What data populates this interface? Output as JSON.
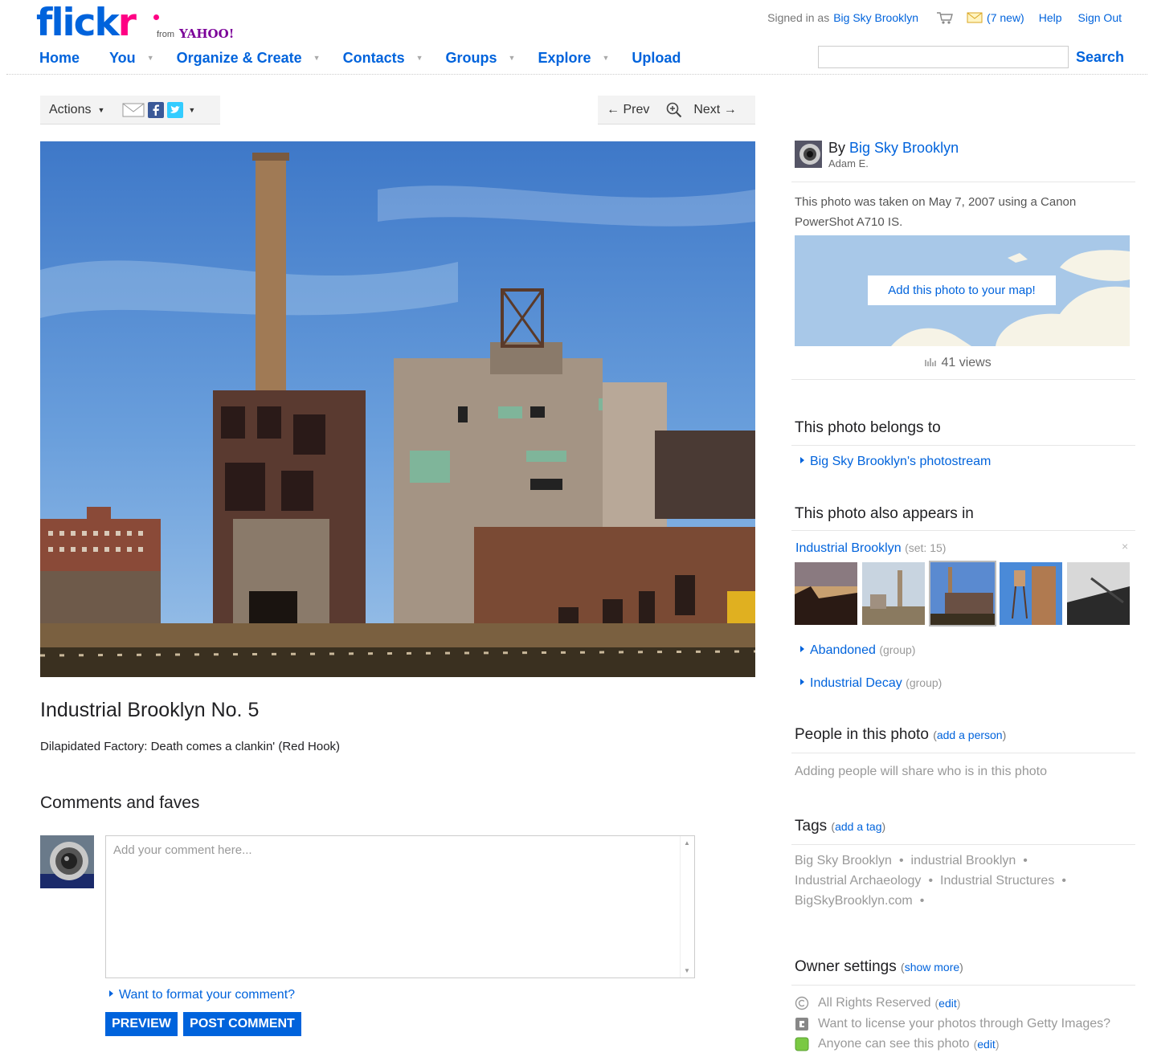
{
  "header": {
    "logo": {
      "part1": "flick",
      "part2": "r",
      "from": "from",
      "yahoo": "YAHOO!"
    },
    "nav": [
      {
        "label": "Home",
        "has_menu": false
      },
      {
        "label": "You",
        "has_menu": true
      },
      {
        "label": "Organize & Create",
        "has_menu": true
      },
      {
        "label": "Contacts",
        "has_menu": true
      },
      {
        "label": "Groups",
        "has_menu": true
      },
      {
        "label": "Explore",
        "has_menu": true
      },
      {
        "label": "Upload",
        "has_menu": false
      }
    ],
    "signed_in_prefix": "Signed in as",
    "user": "Big Sky Brooklyn",
    "mail_count": "(7 new)",
    "help": "Help",
    "sign_out": "Sign Out",
    "search_value": "",
    "search_button": "Search"
  },
  "toolbar": {
    "actions": "Actions",
    "prev": "← Prev",
    "next": "Next →"
  },
  "photo": {
    "title": "Industrial Brooklyn No. 5",
    "description": "Dilapidated Factory: Death comes a clankin' (Red Hook)"
  },
  "comments": {
    "heading": "Comments and faves",
    "placeholder": "Add your comment here...",
    "format_link": "Want to format your comment?",
    "preview": "PREVIEW",
    "post": "POST COMMENT"
  },
  "sidebar": {
    "by_prefix": "By",
    "owner": "Big Sky Brooklyn",
    "owner_real_name": "Adam E.",
    "taken_line1": "This photo was taken on May 7, 2007 using a Canon",
    "taken_line2": "PowerShot A710 IS.",
    "map_button": "Add this photo to your map!",
    "views": "41 views",
    "belongs_heading": "This photo belongs to",
    "photostream": "Big Sky Brooklyn's photostream",
    "appears_heading": "This photo also appears in",
    "set_name": "Industrial Brooklyn",
    "set_meta": "(set: 15)",
    "set_close": "×",
    "groups": [
      {
        "name": "Abandoned",
        "meta": "(group)"
      },
      {
        "name": "Industrial Decay",
        "meta": "(group)"
      }
    ],
    "people_heading": "People in this photo",
    "add_person": "add a person",
    "people_note": "Adding people will share who is in this photo",
    "tags_heading": "Tags",
    "add_tag": "add a tag",
    "tags": [
      "Big Sky Brooklyn",
      "industrial Brooklyn",
      "Industrial Archaeology",
      "Industrial Structures",
      "BigSkyBrooklyn.com"
    ],
    "owner_heading": "Owner settings",
    "show_more": "show more",
    "rights": "All Rights Reserved",
    "license": "Want to license your photos through Getty Images?",
    "visibility": "Anyone can see this photo",
    "edit": "edit"
  }
}
